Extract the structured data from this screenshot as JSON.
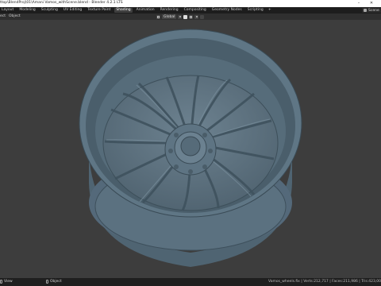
{
  "window": {
    "title": "ttop\\BlendProj\\01\\Amani Vamos_withScene.blend - Blender 4.2.1 LTS",
    "controls": [
      "minimize-icon",
      "close-icon"
    ]
  },
  "workspaces": {
    "tabs": [
      "Layout",
      "Modeling",
      "Sculpting",
      "UV Editing",
      "Texture Paint",
      "Shading",
      "Animation",
      "Rendering",
      "Compositing",
      "Geometry Nodes",
      "Scripting"
    ],
    "active": "Shading",
    "add": "+"
  },
  "scene": {
    "label": "Scene"
  },
  "header": {
    "menu": [
      "ect",
      "Object"
    ],
    "orientation": "Global"
  },
  "viewport": {
    "object": "wheel rim",
    "base_color": "#3d3d3d",
    "rim_color": "#5d7281"
  },
  "statusbar": {
    "left_label": "View",
    "mid_label": "Object",
    "stats": "Vamos_wheels.fix | Verts:212,717 | Faces:211,986 | Tris:423,00"
  }
}
